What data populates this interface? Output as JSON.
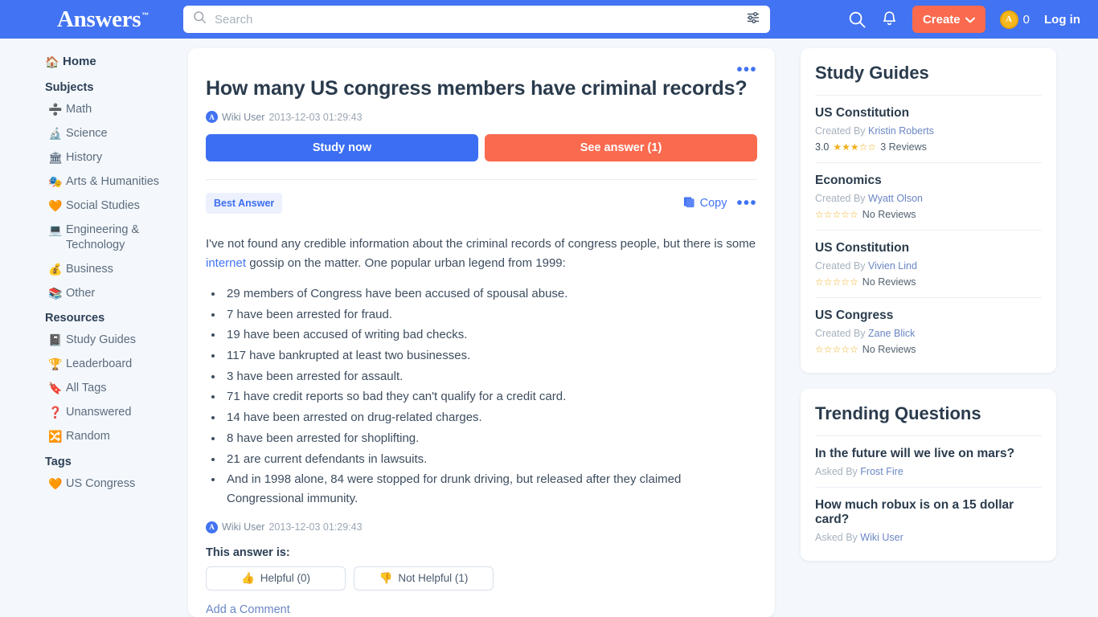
{
  "header": {
    "logo": "Answers",
    "logo_tm": "™",
    "search_placeholder": "Search",
    "search_value": "",
    "create_label": "Create",
    "coin_count": "0",
    "login_label": "Log in",
    "brand_blue": "#4273f2",
    "accent_coral": "#fa6a4e"
  },
  "sidebar": {
    "home": {
      "icon": "🏠",
      "label": "Home"
    },
    "subjects_heading": "Subjects",
    "subjects": [
      {
        "icon": "➗",
        "label": "Math"
      },
      {
        "icon": "🔬",
        "label": "Science"
      },
      {
        "icon": "🏛",
        "label": "History"
      },
      {
        "icon": "🎭",
        "label": "Arts & Humanities"
      },
      {
        "icon": "🧡",
        "label": "Social Studies"
      },
      {
        "icon": "💻",
        "label": "Engineering & Technology"
      },
      {
        "icon": "💰",
        "label": "Business"
      },
      {
        "icon": "📚",
        "label": "Other"
      }
    ],
    "resources_heading": "Resources",
    "resources": [
      {
        "icon": "📓",
        "label": "Study Guides"
      },
      {
        "icon": "🏆",
        "label": "Leaderboard"
      },
      {
        "icon": "🔖",
        "label": "All Tags"
      },
      {
        "icon": "❓",
        "label": "Unanswered"
      },
      {
        "icon": "🔀",
        "label": "Random"
      }
    ],
    "tags_heading": "Tags",
    "tags": [
      {
        "icon": "🧡",
        "label": "US Congress"
      }
    ]
  },
  "question": {
    "title": "How many US congress members have criminal records?",
    "author": "Wiki User",
    "timestamp": "2013-12-03 01:29:43",
    "avatar_letter": "A",
    "study_now_label": "Study now",
    "see_answer_label": "See answer (1)"
  },
  "answer": {
    "badge": "Best Answer",
    "copy_label": "Copy",
    "paragraph_before": "I've not found any credible information about the criminal records of congress people, but there is some ",
    "link_text": "internet",
    "paragraph_after": " gossip on the matter. One popular urban legend from 1999:",
    "bullets": [
      "29 members of Congress have been accused of spousal abuse.",
      "7 have been arrested for fraud.",
      "19 have been accused of writing bad checks.",
      "117 have bankrupted at least two businesses.",
      "3 have been arrested for assault.",
      "71 have credit reports so bad they can't qualify for a credit card.",
      "14 have been arrested on drug-related charges.",
      "8 have been arrested for shoplifting.",
      "21 are current defendants in lawsuits.",
      "And in 1998 alone, 84 were stopped for drunk driving, but released after they claimed Congressional immunity."
    ],
    "author": "Wiki User",
    "timestamp": "2013-12-03 01:29:43",
    "this_answer_is": "This answer is:",
    "helpful_label": "Helpful (0)",
    "not_helpful_label": "Not Helpful (1)",
    "helpful_icon": "👍",
    "not_helpful_icon": "👎",
    "add_comment": "Add a Comment"
  },
  "study_guides": {
    "title": "Study Guides",
    "created_by_label": "Created By",
    "items": [
      {
        "title": "US Constitution",
        "author": "Kristin Roberts",
        "score": "3.0",
        "stars_filled": 3,
        "reviews": "3 Reviews"
      },
      {
        "title": "Economics",
        "author": "Wyatt Olson",
        "score": "",
        "stars_filled": 0,
        "reviews": "No Reviews"
      },
      {
        "title": "US Constitution",
        "author": "Vivien Lind",
        "score": "",
        "stars_filled": 0,
        "reviews": "No Reviews"
      },
      {
        "title": "US Congress",
        "author": "Zane Blick",
        "score": "",
        "stars_filled": 0,
        "reviews": "No Reviews"
      }
    ]
  },
  "trending": {
    "title": "Trending Questions",
    "asked_by_label": "Asked By",
    "items": [
      {
        "title": "In the future will we live on mars?",
        "author": "Frost Fire"
      },
      {
        "title": "How much robux is on a 15 dollar card?",
        "author": "Wiki User"
      }
    ]
  }
}
